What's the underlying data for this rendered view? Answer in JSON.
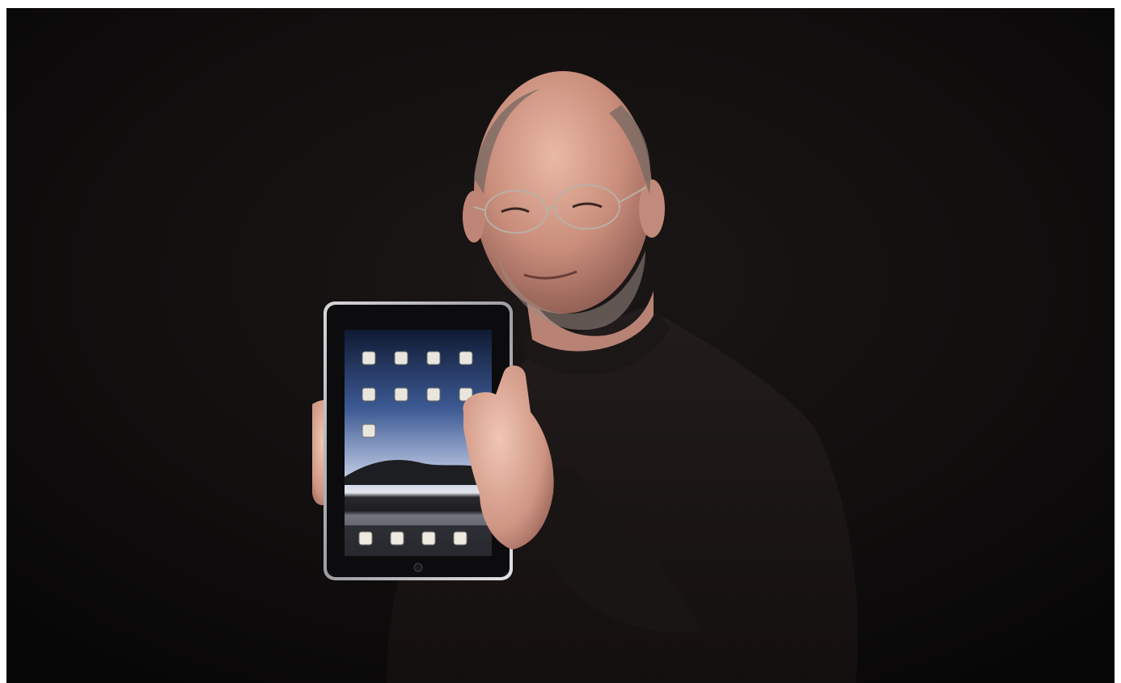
{
  "scene": {
    "background_color": "#0f0c0c",
    "border_color": "#ffffff",
    "subject": "person-holding-tablet",
    "device_screen_colors": {
      "sky_top": "#1c2a4a",
      "sky_mid": "#5b78b0",
      "horizon": "#d8dbe6",
      "mountain": "#2a2a2e",
      "water": "#6d6f78"
    }
  }
}
